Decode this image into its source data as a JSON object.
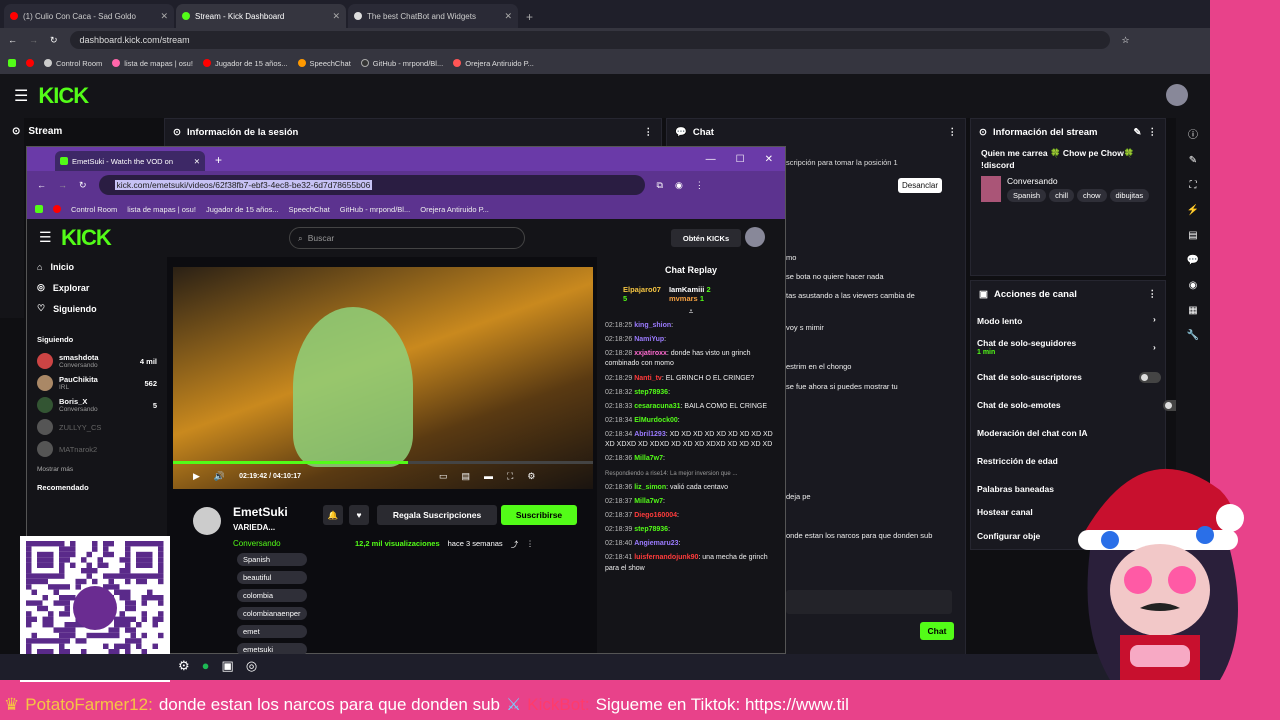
{
  "outer_browser": {
    "tabs": [
      {
        "label": "(1) Culio Con Caca - Sad Goldo"
      },
      {
        "label": "Stream - Kick Dashboard"
      },
      {
        "label": "The best ChatBot and Widgets"
      }
    ],
    "url": "dashboard.kick.com/stream",
    "bookmarks": [
      "Control Room",
      "lista de mapas | osu!",
      "Jugador de 15 años...",
      "SpeechChat",
      "GitHub - mrpond/Bl...",
      "Orejera Antiruido P..."
    ]
  },
  "dashboard": {
    "logo": "KICK",
    "stream_label": "Stream",
    "session_info_title": "Información de la sesión",
    "chat_title": "Chat",
    "chat_position_hint": "scripción para tomar la posición 1",
    "unpin_label": "Desanclar",
    "chat_fragments": [
      "mo",
      "se bota no quiere hacer nada",
      "tas asustando a las viewers cambia de",
      "voy s mimir",
      "estrim en el chongo",
      "se fue ahora si puedes mostrar tu",
      "deja pe",
      "onde estan los narcos para que donden sub"
    ],
    "chat_send_label": "Chat",
    "stream_info": {
      "title": "Información del stream",
      "stream_title": "Quien me carrea 🍀 Chow pe Chow🍀 !discord",
      "category": "Conversando",
      "tags": [
        "Spanish",
        "chill",
        "chow",
        "dibujitas"
      ]
    },
    "channel_actions": {
      "title": "Acciones de canal",
      "items": [
        {
          "label": "Modo lento",
          "sub": ""
        },
        {
          "label": "Chat de solo-seguidores",
          "sub": "1 min"
        },
        {
          "label": "Chat de solo-suscriptores",
          "sub": ""
        },
        {
          "label": "Chat de solo-emotes",
          "sub": ""
        },
        {
          "label": "Moderación del chat con IA",
          "sub": ""
        },
        {
          "label": "Restricción de edad",
          "sub": ""
        },
        {
          "label": "Palabras baneadas",
          "sub": ""
        },
        {
          "label": "Hostear canal",
          "sub": ""
        },
        {
          "label": "Configurar obje",
          "sub": ""
        }
      ]
    }
  },
  "inner_browser": {
    "tab_label": "EmetSuki - Watch the VOD on",
    "url": "kick.com/emetsuki/videos/62f38fb7-ebf3-4ec8-be32-6d7d78655b06",
    "bookmarks": [
      "Control Room",
      "lista de mapas | osu!",
      "Jugador de 15 años...",
      "SpeechChat",
      "GitHub - mrpond/Bl...",
      "Orejera Antiruido P..."
    ],
    "search_placeholder": "Buscar",
    "get_kicks": "Obtén KICKs",
    "nav": [
      "Inicio",
      "Explorar",
      "Siguiendo"
    ],
    "following_title": "Siguiendo",
    "following": [
      {
        "name": "smashdota",
        "sub": "Conversando",
        "viewers": "4 mil"
      },
      {
        "name": "PauChikita",
        "sub": "IRL",
        "viewers": "562"
      },
      {
        "name": "Boris_X",
        "sub": "Conversando",
        "viewers": "5"
      },
      {
        "name": "ZULLYY_CS",
        "sub": "",
        "viewers": ""
      },
      {
        "name": "MATnarok2",
        "sub": "",
        "viewers": ""
      }
    ],
    "show_more": "Mostrar más",
    "recommended": "Recomendado",
    "video_time": "02:19:42 / 04:10:17",
    "channel_name": "EmetSuki",
    "video_title": "VARIEDA...",
    "category": "Conversando",
    "gift_subs": "Regala Suscripciones",
    "subscribe": "Suscribirse",
    "views": "12,2 mil visualizaciones",
    "ago": "hace 3 semanas",
    "tags": [
      "Spanish",
      "beautiful",
      "colombia",
      "colombianaenper",
      "emet",
      "emetsuki"
    ],
    "chat_replay_title": "Chat Replay",
    "top_gifters": [
      {
        "name": "Elpajaro07",
        "count": "5"
      },
      {
        "name": "IamKamiii",
        "count": "2"
      },
      {
        "name": "mvmars",
        "count": "1"
      }
    ],
    "replay_messages": [
      {
        "time": "02:18:25",
        "user": "king_shion",
        "color": "#9b7bff",
        "text": ""
      },
      {
        "time": "02:18:26",
        "user": "NamiYup",
        "color": "#9b7bff",
        "text": ""
      },
      {
        "time": "02:18:28",
        "user": "xxjatiroxx",
        "color": "#ff6bd0",
        "text": "donde has visto un grinch combinado con momo"
      },
      {
        "time": "02:18:29",
        "user": "Nanti_tv",
        "color": "#ff3b3b",
        "text": "EL GRINCH O EL CRINGE?"
      },
      {
        "time": "02:18:32",
        "user": "step78936",
        "color": "#53fc18",
        "text": ""
      },
      {
        "time": "02:18:33",
        "user": "cesaracuna31",
        "color": "#53fc18",
        "text": "BAILA COMO EL CRINGE"
      },
      {
        "time": "02:18:34",
        "user": "ElMurdock00",
        "color": "#53fc18",
        "text": ""
      },
      {
        "time": "02:18:34",
        "user": "Abril1293",
        "color": "#9b7bff",
        "text": "XD XD XD XD XD XD XD XD XD XD XDXD XD XDXD XD XD XD XDXD XD XD XD XD"
      },
      {
        "time": "02:18:36",
        "user": "Milla7w7",
        "color": "#53fc18",
        "text": ""
      },
      {
        "time": "",
        "user": "",
        "color": "#aaa",
        "text": "Respondiendo a rise14: La mejor inversion que ..."
      },
      {
        "time": "02:18:36",
        "user": "liz_simon",
        "color": "#53fc18",
        "text": "valió cada centavo"
      },
      {
        "time": "02:18:37",
        "user": "Milla7w7",
        "color": "#53fc18",
        "text": ""
      },
      {
        "time": "02:18:37",
        "user": "Diego160004",
        "color": "#ff3b3b",
        "text": ""
      },
      {
        "time": "02:18:39",
        "user": "step78936",
        "color": "#53fc18",
        "text": ""
      },
      {
        "time": "02:18:40",
        "user": "Angiemaru23",
        "color": "#9b7bff",
        "text": ""
      },
      {
        "time": "02:18:41",
        "user": "luisfernandojunk90",
        "color": "#ff3b3b",
        "text": "una mecha de grinch para el show"
      }
    ]
  },
  "ticker": {
    "user1": "PotatoFarmer12:",
    "text1": "donde estan los narcos para que donden sub",
    "user2": "KickBot:",
    "text2": "Sigueme en Tiktok: https://www.til"
  },
  "colors": {
    "kick_green": "#53fc18",
    "overlay_pink": "#e8428a",
    "inner_purple": "#5c338f"
  }
}
